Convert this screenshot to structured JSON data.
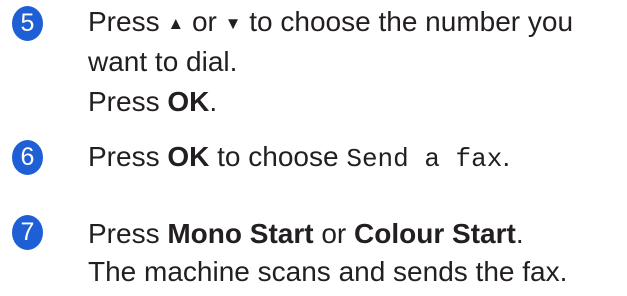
{
  "steps": [
    {
      "number": "5",
      "line1": {
        "press": "Press",
        "up_arrow": "▲",
        "or": "or",
        "down_arrow": "▼",
        "rest": "to choose the number you"
      },
      "line2": "want to dial.",
      "line3": {
        "press": "Press",
        "ok": "OK",
        "period": "."
      }
    },
    {
      "number": "6",
      "press": "Press",
      "ok": "OK",
      "middle": "to choose",
      "lcd_text": "Send a fax",
      "period": "."
    },
    {
      "number": "7",
      "line1": {
        "press": "Press",
        "mono_start": "Mono Start",
        "or": "or",
        "colour_start": "Colour Start",
        "period": "."
      },
      "line2": "The machine scans and sends the fax."
    }
  ],
  "colors": {
    "badge": "#1f5fd6",
    "text": "#231f20"
  }
}
